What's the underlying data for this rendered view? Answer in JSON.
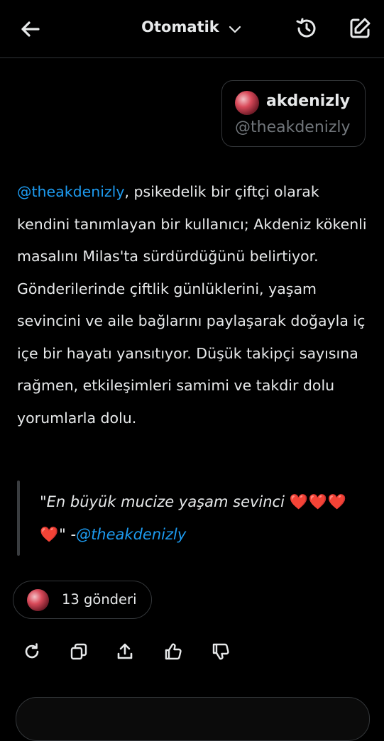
{
  "header": {
    "title": "Otomatik",
    "back_icon": "arrow-left-icon",
    "dropdown_icon": "chevron-down-icon",
    "history_icon": "history-icon",
    "compose_icon": "compose-icon"
  },
  "user_card": {
    "name": "akdenizly",
    "handle": "@theakdenizly"
  },
  "summary": {
    "mention": "@theakdenizly",
    "text": ", psikedelik bir çiftçi olarak kendini tanımlayan bir kullanıcı; Akdeniz kökenli masalını Milas'ta sürdürdüğünü belirtiyor. Gönderilerinde çiftlik günlüklerini, yaşam sevincini ve aile bağlarını paylaşarak doğayla iç içe bir hayatı yansıtıyor. Düşük takipçi sayısına rağmen, etkileşimleri samimi ve takdir dolu yorumlarla dolu."
  },
  "quote": {
    "text": "\"En büyük mucize yaşam sevinci ",
    "hearts": "❤️❤️❤️❤️",
    "suffix": "\" -",
    "mention": "@theakdenizly"
  },
  "posts": {
    "label": "13 gönderi"
  },
  "actions": [
    "refresh-icon",
    "copy-icon",
    "share-icon",
    "thumbs-up-icon",
    "thumbs-down-icon"
  ],
  "colors": {
    "background": "#000000",
    "text": "#e7e9ea",
    "mention": "#1d9bf0",
    "muted": "#71767b",
    "heart": "#e0243f"
  }
}
